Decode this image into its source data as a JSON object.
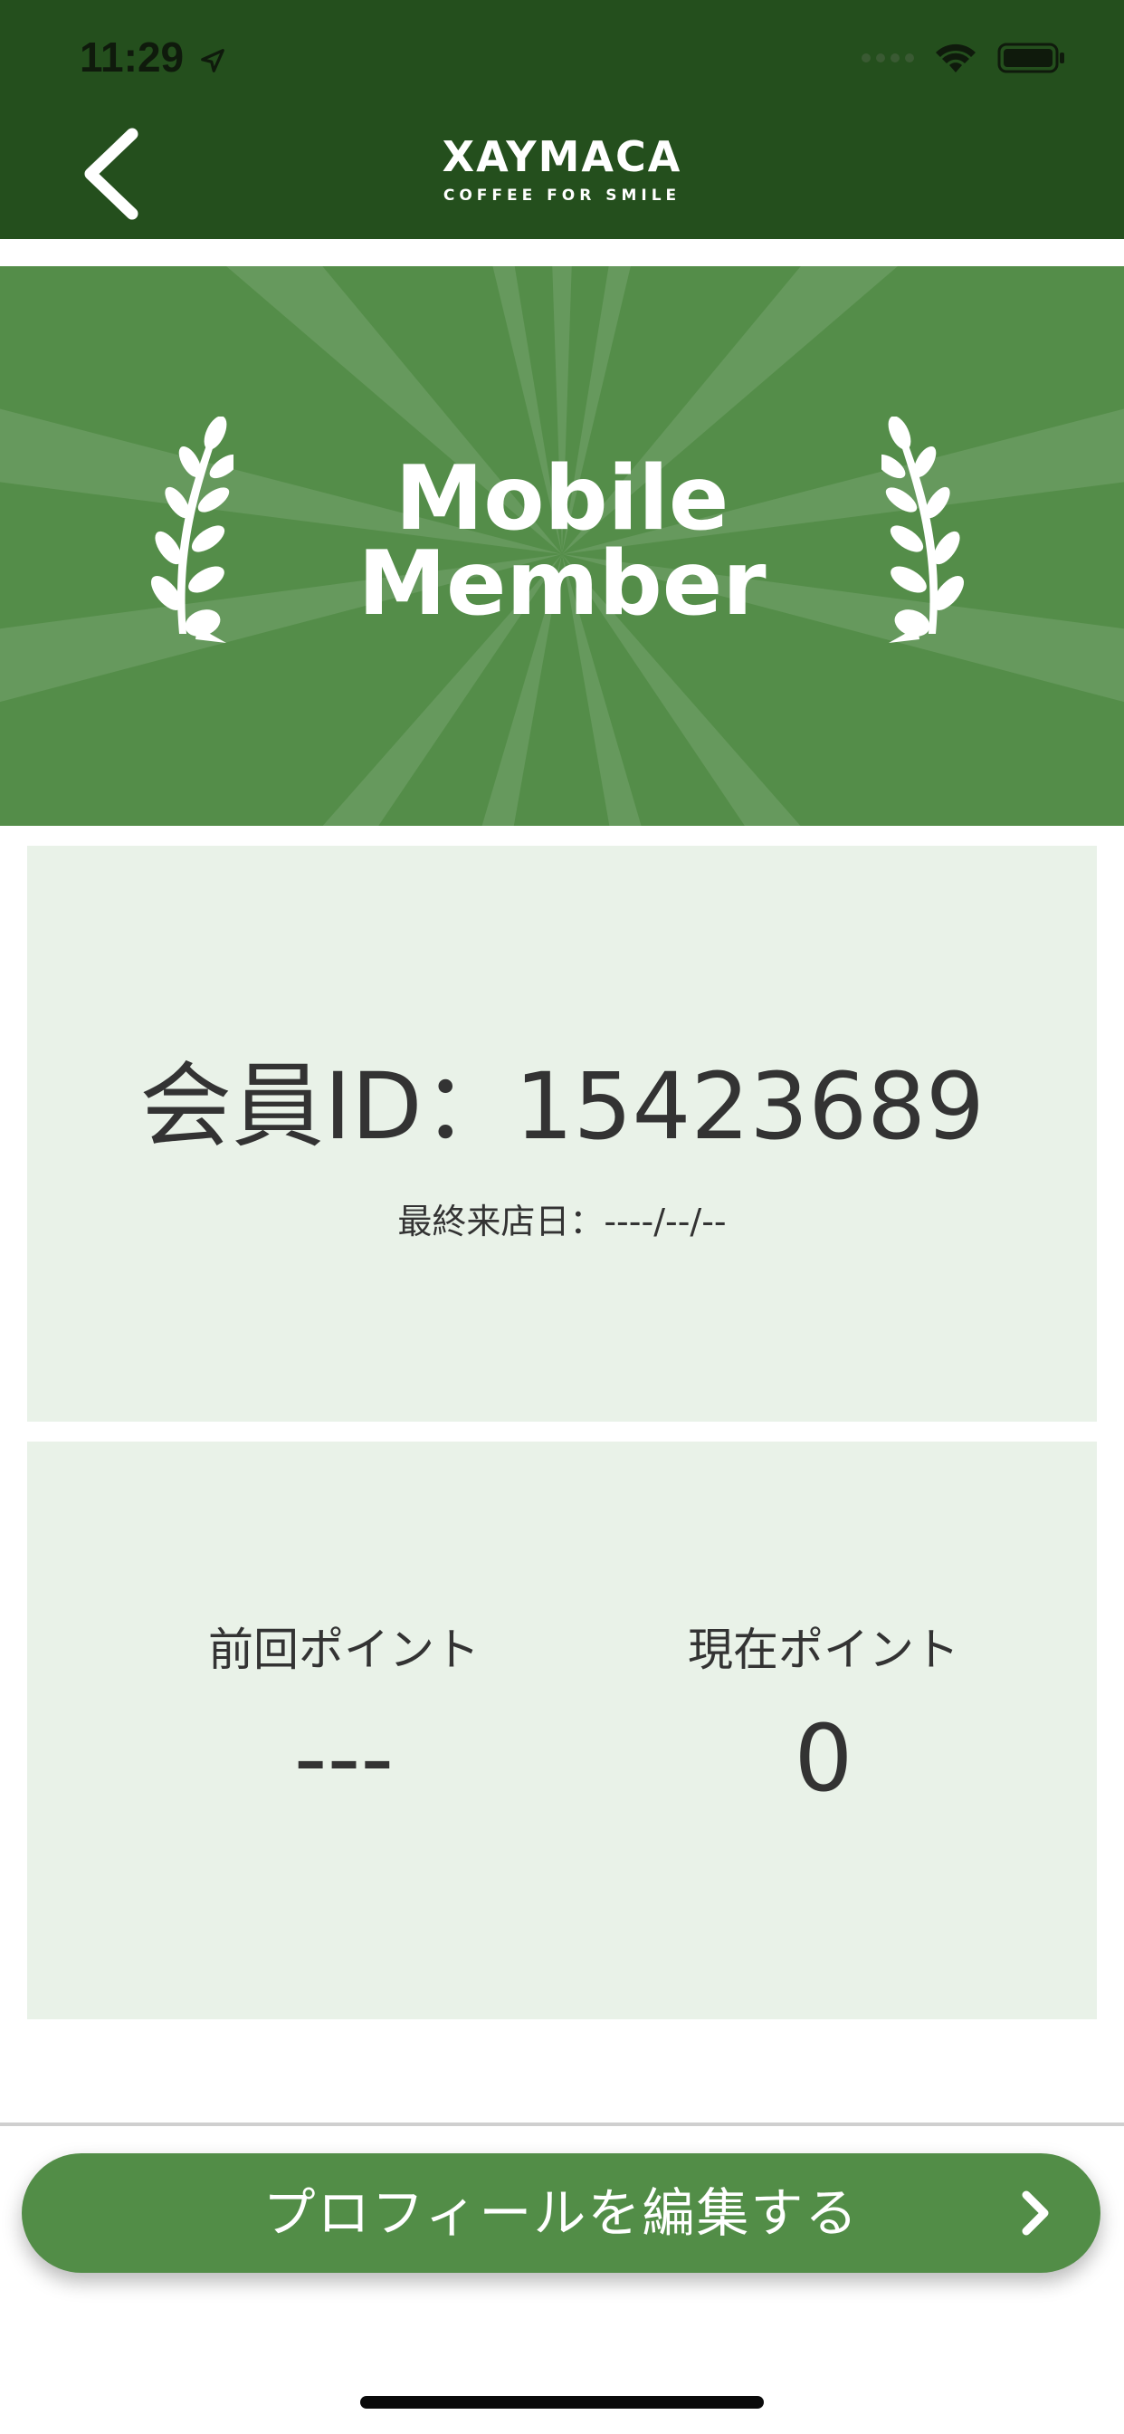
{
  "status_bar": {
    "time": "11:29"
  },
  "header": {
    "brand_name": "XAYMACA",
    "brand_tagline": "COFFEE FOR SMILE",
    "background_color": "#244f1d"
  },
  "banner": {
    "title_line1": "Mobile",
    "title_line2": "Member",
    "background_color": "#548d49"
  },
  "member_card": {
    "member_id_label": "会員ID：15423689",
    "last_visit_label": "最終来店日：----/--/--"
  },
  "points_card": {
    "previous_label": "前回ポイント",
    "previous_value": "---",
    "current_label": "現在ポイント",
    "current_value": "0"
  },
  "actions": {
    "edit_profile_label": "プロフィールを編集する"
  },
  "icons": {
    "back": "back-chevron-icon",
    "location": "location-arrow-icon",
    "wifi": "wifi-icon",
    "battery": "battery-icon",
    "laurel": "laurel-branch-icon",
    "forward": "chevron-right-icon"
  },
  "colors": {
    "accent": "#528d47",
    "card_background": "#e9f2e8",
    "text": "#333333"
  }
}
